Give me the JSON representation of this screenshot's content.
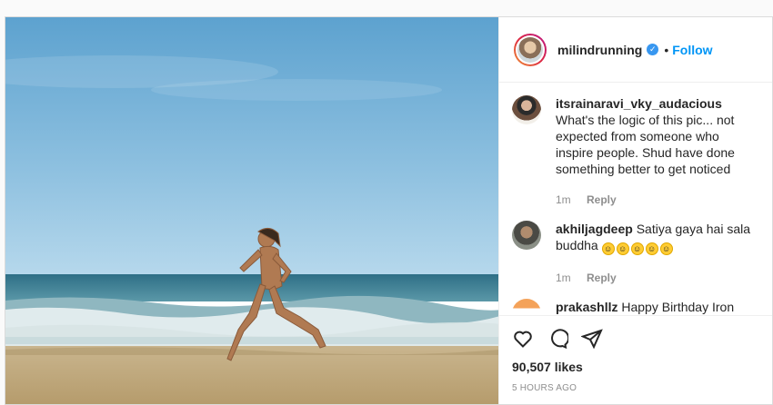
{
  "post": {
    "author": "milindrunning",
    "verified_icon": "verified-badge-icon",
    "separator": "•",
    "follow_label": "Follow"
  },
  "comments": [
    {
      "username": "itsrainaravi_vky_audacious",
      "text": " What's the logic of this pic... not expected from someone who inspire people. Shud have done something better to get noticed",
      "age": "1m",
      "reply_label": "Reply"
    },
    {
      "username": "akhiljagdeep",
      "text": " Satiya gaya hai sala buddha",
      "emoji_count": 5,
      "age": "1m",
      "reply_label": "Reply"
    },
    {
      "username": "prakashllz",
      "text": " Happy Birthday Iron"
    }
  ],
  "likes": "90,507 likes",
  "posted": "5 HOURS AGO",
  "colors": {
    "follow": "#0095f6",
    "verified": "#3897f0",
    "muted": "#8e8e8e"
  }
}
